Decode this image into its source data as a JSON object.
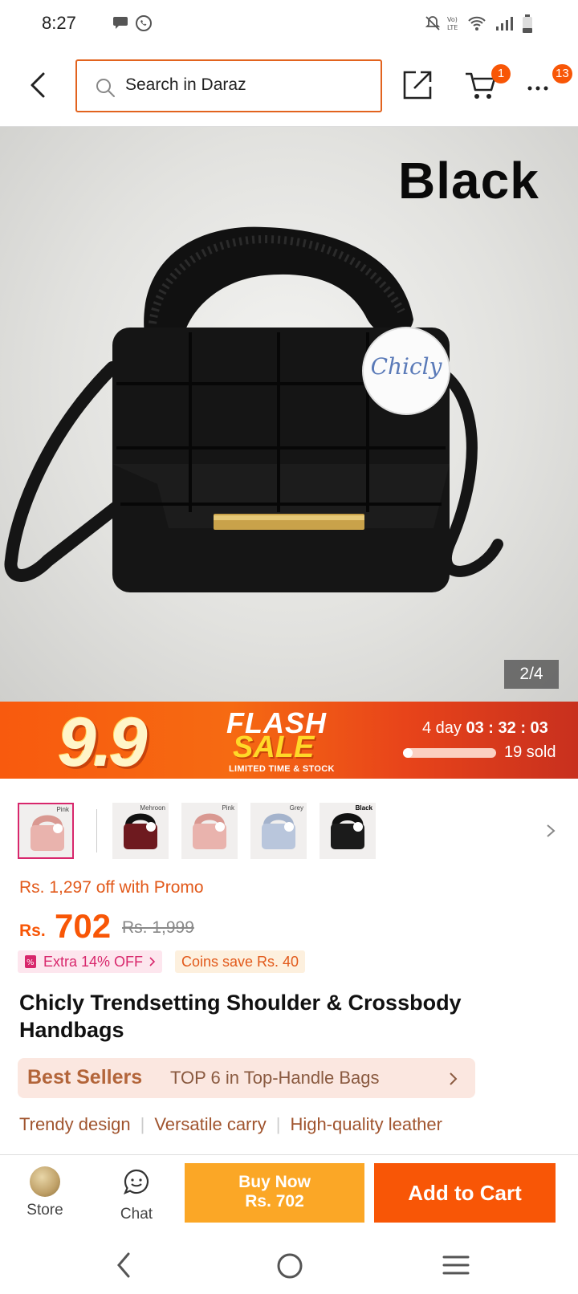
{
  "status_bar": {
    "time": "8:27",
    "battery_percent": 30
  },
  "search": {
    "placeholder": "Search in Daraz"
  },
  "nav": {
    "cart_count": "1",
    "more_count": "13"
  },
  "hero": {
    "color_label": "Black",
    "image_counter": "2/4",
    "brand_tag": "Chicly"
  },
  "flash_sale": {
    "campaign": "9.9",
    "title_line1": "FLASH",
    "title_line2": "SALE",
    "subtitle": "LIMITED TIME & STOCK",
    "days": "4 day",
    "countdown": "03 : 32 : 03",
    "sold": "19 sold",
    "sold_progress": 0.1
  },
  "thumbnails": [
    {
      "variant": "Pink",
      "color": "#e9b3ad",
      "selected": true
    },
    {
      "variant": "Mehroon",
      "color": "#6e1a1f",
      "selected": false
    },
    {
      "variant": "Pink",
      "color": "#e9b3ad",
      "selected": false
    },
    {
      "variant": "Grey",
      "color": "#b9c6dc",
      "selected": false
    },
    {
      "variant": "Black",
      "color": "#1b1b1b",
      "selected": false
    }
  ],
  "price": {
    "promo_text": "Rs. 1,297 off with Promo",
    "currency": "Rs.",
    "current": "702",
    "original": "Rs. 1,999"
  },
  "tags": {
    "extra": "Extra 14% OFF",
    "coins": "Coins save Rs. 40"
  },
  "product": {
    "title": "Chicly Trendsetting Shoulder & Crossbody Handbags"
  },
  "best_sellers": {
    "label": "Best Sellers",
    "rank_text": "TOP 6 in Top-Handle Bags"
  },
  "features": [
    "Trendy design",
    "Versatile carry",
    "High-quality leather"
  ],
  "actions": {
    "store_label": "Store",
    "chat_label": "Chat",
    "buy_now_line1": "Buy Now",
    "buy_now_line2": "Rs. 702",
    "add_to_cart": "Add to Cart"
  },
  "colors": {
    "accent": "#f85606",
    "buy_now": "#fba726",
    "search_border": "#e2631e",
    "selected_thumb": "#d8276c"
  }
}
